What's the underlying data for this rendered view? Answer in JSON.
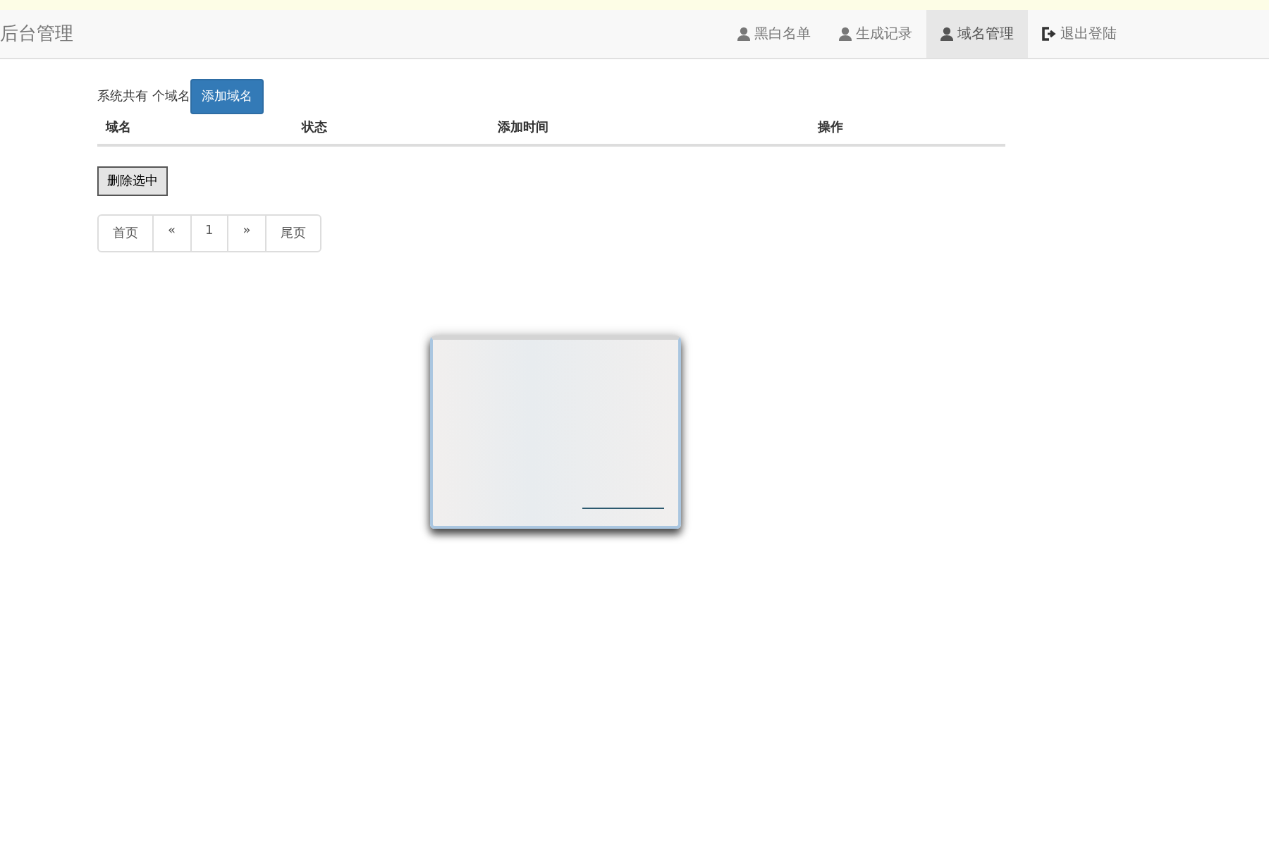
{
  "navbar": {
    "brand": "后台管理",
    "items": [
      {
        "label": "黑白名单",
        "kind": "user",
        "selected": false
      },
      {
        "label": "生成记录",
        "kind": "user",
        "selected": false
      },
      {
        "label": "域名管理",
        "kind": "user",
        "selected": true
      },
      {
        "label": "退出登陆",
        "kind": "logout",
        "selected": false
      }
    ]
  },
  "summary": {
    "text": "系统共有 个域名",
    "add_button": "添加域名"
  },
  "table": {
    "columns": [
      "域名",
      "状态",
      "添加时间",
      "操作"
    ]
  },
  "delete_button": "删除选中",
  "pagination": [
    {
      "label": "首页"
    },
    {
      "label": "«"
    },
    {
      "label": "1"
    },
    {
      "label": "»"
    },
    {
      "label": "尾页"
    }
  ]
}
